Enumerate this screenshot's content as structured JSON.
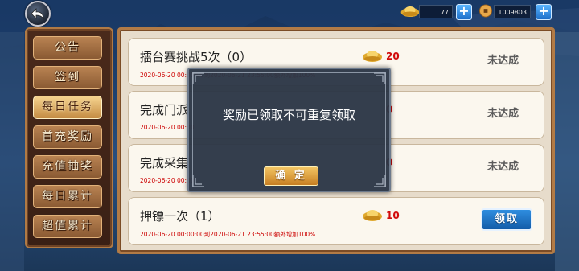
{
  "topbar": {
    "gold_ingot_value": "77",
    "coin_value": "1009803"
  },
  "sidebar": {
    "items": [
      {
        "label": "公告"
      },
      {
        "label": "签到"
      },
      {
        "label": "每日任务",
        "active": true
      },
      {
        "label": "首充奖励"
      },
      {
        "label": "充值抽奖"
      },
      {
        "label": "每日累计"
      },
      {
        "label": "超值累计"
      }
    ]
  },
  "tasks": [
    {
      "title": "擂台赛挑战5次（0）",
      "date": "2020-06-20 00:00:00到2020-06-21 23:55:00额外增加100%",
      "reward": "20",
      "status": "未达成"
    },
    {
      "title": "完成门派",
      "date": "2020-06-20 00:00",
      "reward": "0",
      "status": "未达成"
    },
    {
      "title": "完成采集",
      "date": "2020-06-20 00:00",
      "reward": "0",
      "status": "未达成"
    },
    {
      "title": "押镖一次（1）",
      "date": "2020-06-20 00:00:00到2020-06-21 23:55:00额外增加100%",
      "reward": "10",
      "status": "领取"
    }
  ],
  "modal": {
    "message": "奖励已领取不可重复领取",
    "ok_label": "确 定"
  },
  "colors": {
    "reward_red": "#d10b0b",
    "claim_blue": "#1f74c8",
    "ok_gold": "#e0a23e"
  }
}
